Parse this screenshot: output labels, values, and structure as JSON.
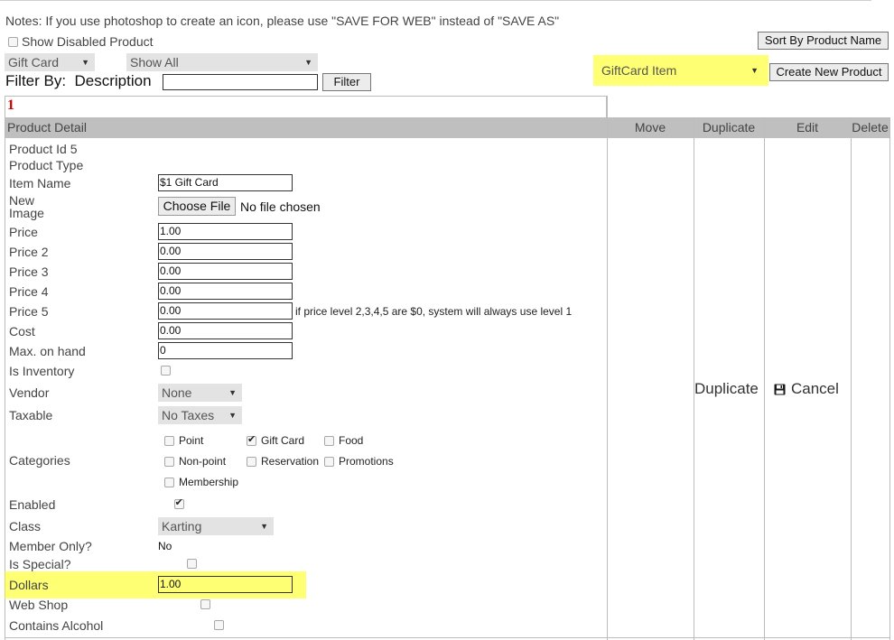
{
  "notes": "Notes: If you use photoshop to create an icon, please use \"SAVE FOR WEB\" instead of \"SAVE AS\"",
  "show_disabled_label": "Show Disabled Product",
  "sort_button": "Sort By Product Name",
  "filter": {
    "type_select": "Gift Card",
    "show_select": "Show All",
    "label": "Filter By:  Description",
    "value": "",
    "button": "Filter"
  },
  "new_product": {
    "type_select": "GiftCard Item",
    "button": "Create New Product"
  },
  "page_number": "1",
  "table": {
    "headers": [
      "Product Detail",
      "Move",
      "Duplicate",
      "Edit",
      "Delete"
    ]
  },
  "product": {
    "product_id": "Product Id 5",
    "product_type": "Product Type",
    "item_name_label": "Item Name",
    "item_name": "$1 Gift Card",
    "new_image_label_1": "New",
    "new_image_label_2": "Image",
    "choose_file": "Choose File",
    "no_file": "No file chosen",
    "price_label": "Price",
    "price": "1.00",
    "price2_label": "Price 2",
    "price2": "0.00",
    "price3_label": "Price 3",
    "price3": "0.00",
    "price4_label": "Price 4",
    "price4": "0.00",
    "price5_label": "Price 5",
    "price5": "0.00",
    "price_note": "if price level 2,3,4,5 are $0, system will always use level 1",
    "cost_label": "Cost",
    "cost": "0.00",
    "max_on_hand_label": "Max. on hand",
    "max_on_hand": "0",
    "is_inventory_label": "Is Inventory",
    "vendor_label": "Vendor",
    "vendor": "None",
    "taxable_label": "Taxable",
    "taxable": "No Taxes",
    "categories_label": "Categories",
    "categories": [
      {
        "label": "Point",
        "checked": false
      },
      {
        "label": "Gift Card",
        "checked": true
      },
      {
        "label": "Food",
        "checked": false
      },
      {
        "label": "Non-point",
        "checked": false
      },
      {
        "label": "Reservation",
        "checked": false
      },
      {
        "label": "Promotions",
        "checked": false
      },
      {
        "label": "Membership",
        "checked": false
      }
    ],
    "enabled_label": "Enabled",
    "class_label": "Class",
    "class": "Karting",
    "member_only_label": "Member Only?",
    "member_only": "No",
    "is_special_label": "Is Special?",
    "dollars_label": "Dollars",
    "dollars": "1.00",
    "web_shop_label": "Web Shop",
    "contains_alcohol_label": "Contains Alcohol"
  },
  "actions": {
    "duplicate": "Duplicate",
    "cancel": "Cancel",
    "save_icon": "floppy-disk-icon"
  },
  "colors": {
    "highlight": "#ffff00",
    "page_number": "#cc0000",
    "header_bg": "#bfbfbf"
  }
}
